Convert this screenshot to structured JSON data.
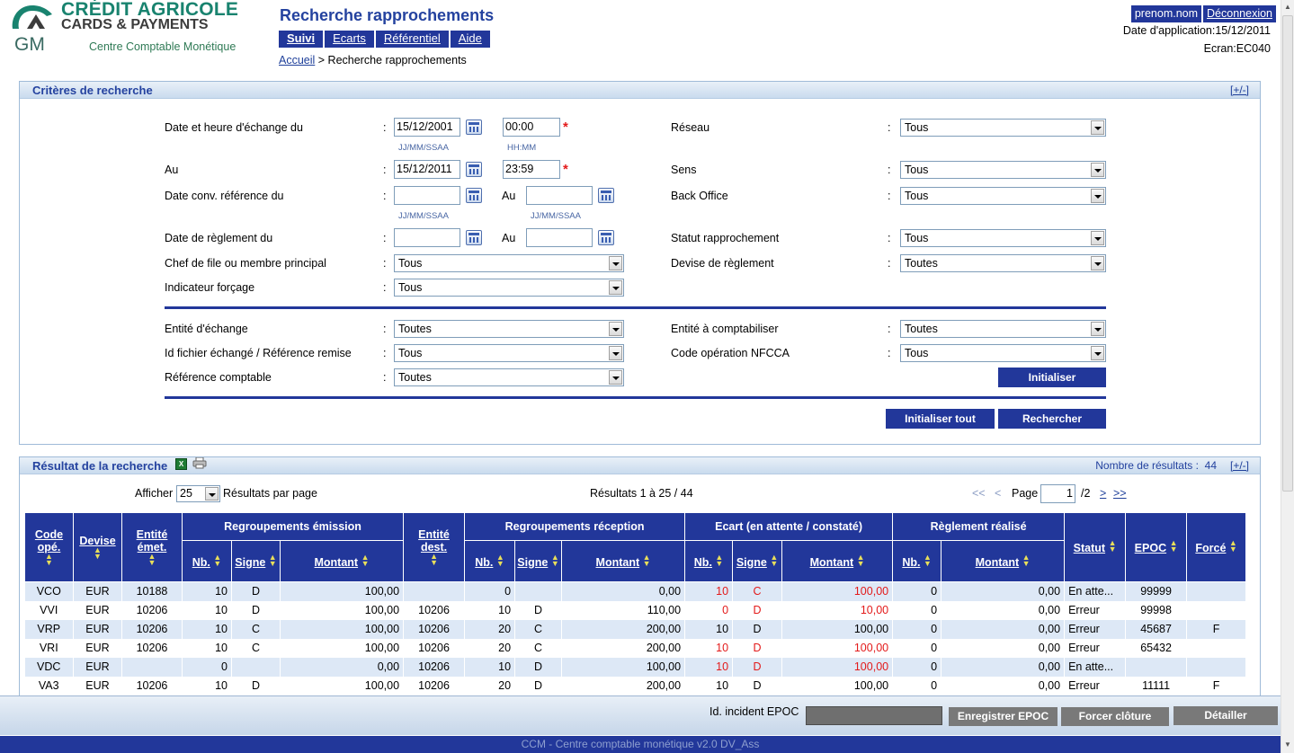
{
  "header": {
    "logo_line1": "CRÉDIT AGRICOLE",
    "logo_line2": "CARDS & PAYMENTS",
    "logo_gm": "GM",
    "logo_sub": "Centre Comptable Monétique",
    "page_title": "Recherche rapprochements",
    "menu": [
      "Suivi",
      "Ecarts",
      "Référentiel",
      "Aide"
    ],
    "breadcrumb_home": "Accueil",
    "breadcrumb_current": "> Recherche rapprochements",
    "user": "prenom.nom",
    "logout": "Déconnexion",
    "date_app": "Date d'application:15/12/2011",
    "ecran": "Ecran:EC040"
  },
  "criteria": {
    "title": "Critères de recherche",
    "toggle": "[+/-]",
    "labels": {
      "date_exchange_from": "Date et heure d'échange du",
      "to": "Au",
      "date_conv_from": "Date conv. référence du",
      "au_inline": "Au",
      "date_settle_from": "Date de règlement du",
      "lead_member": "Chef de file ou membre principal",
      "forcing": "Indicateur forçage",
      "network": "Réseau",
      "direction": "Sens",
      "back_office": "Back Office",
      "match_status": "Statut rapprochement",
      "settle_currency": "Devise de règlement",
      "exchange_entity": "Entité d'échange",
      "file_id": "Id fichier échangé / Référence remise",
      "accounting_ref": "Référence comptable",
      "accounting_entity": "Entité à comptabiliser",
      "nfcca_code": "Code opération NFCCA"
    },
    "colon": ":",
    "values": {
      "date_exchange_from": "15/12/2001",
      "time_from": "00:00",
      "date_exchange_to": "15/12/2011",
      "time_to": "23:59",
      "date_conv_from": "",
      "date_conv_to": "",
      "date_settle_from": "",
      "date_settle_to": "",
      "lead_member": "Tous",
      "forcing": "Tous",
      "network": "Tous",
      "direction": "Tous",
      "back_office": "Tous",
      "match_status": "Tous",
      "settle_currency": "Toutes",
      "exchange_entity": "Toutes",
      "file_id": "Tous",
      "accounting_ref": "Toutes",
      "accounting_entity": "Toutes",
      "nfcca_code": "Tous"
    },
    "hint_date": "JJ/MM/SSAA",
    "hint_time": "HH:MM",
    "required": "*",
    "btn_reset": "Initialiser",
    "btn_reset_all": "Initialiser tout",
    "btn_search": "Rechercher"
  },
  "results": {
    "title": "Résultat de la recherche",
    "count_label": "Nombre de résultats :",
    "count": "44",
    "toggle": "[+/-]",
    "show_label": "Afficher",
    "page_size": "25",
    "per_page": "Résultats par page",
    "range": "Résultats 1 à 25 / 44",
    "first": "<<",
    "prev": "<",
    "page_label": "Page",
    "page": "1",
    "page_total": "/2",
    "next": ">",
    "last": ">>",
    "group_headers": {
      "emission": "Regroupements émission",
      "reception": "Regroupements réception",
      "ecart": "Ecart (en attente / constaté)",
      "reglement": "Règlement réalisé"
    },
    "columns": {
      "code": "Code opé.",
      "devise": "Devise",
      "entite_emet": "Entité émet.",
      "nb": "Nb.",
      "signe": "Signe",
      "montant": "Montant",
      "entite_dest": "Entité dest.",
      "statut": "Statut",
      "epoc": "EPOC",
      "force": "Forcé"
    },
    "rows": [
      [
        "VCO",
        "EUR",
        "10188",
        "10",
        "D",
        "100,00",
        "",
        "0",
        "",
        "0,00",
        "10",
        "C",
        "100,00",
        "0",
        "0,00",
        "En atte...",
        "99999",
        ""
      ],
      [
        "VVI",
        "EUR",
        "10206",
        "10",
        "D",
        "100,00",
        "10206",
        "10",
        "D",
        "110,00",
        "0",
        "D",
        "10,00",
        "0",
        "0,00",
        "Erreur",
        "99998",
        ""
      ],
      [
        "VRP",
        "EUR",
        "10206",
        "10",
        "C",
        "100,00",
        "10206",
        "20",
        "C",
        "200,00",
        "10",
        "D",
        "100,00",
        "0",
        "0,00",
        "Erreur",
        "45687",
        "F"
      ],
      [
        "VRI",
        "EUR",
        "10206",
        "10",
        "C",
        "100,00",
        "10206",
        "20",
        "C",
        "200,00",
        "10",
        "D",
        "100,00",
        "0",
        "0,00",
        "Erreur",
        "65432",
        ""
      ],
      [
        "VDC",
        "EUR",
        "",
        "0",
        "",
        "0,00",
        "10206",
        "10",
        "D",
        "100,00",
        "10",
        "D",
        "100,00",
        "0",
        "0,00",
        "En atte...",
        "",
        ""
      ],
      [
        "VA3",
        "EUR",
        "10206",
        "10",
        "D",
        "100,00",
        "10206",
        "20",
        "D",
        "200,00",
        "10",
        "D",
        "100,00",
        "0",
        "0,00",
        "Erreur",
        "11111",
        "F"
      ]
    ],
    "red_flags": [
      true,
      true,
      false,
      true,
      true,
      false
    ]
  },
  "actions": {
    "incident_label": "Id. incident EPOC",
    "incident_value": "",
    "btn_register": "Enregistrer EPOC",
    "btn_force": "Forcer clôture",
    "btn_detail": "Détailler"
  },
  "footer": {
    "text": "CCM - Centre comptable monétique v2.0 DV_Ass"
  },
  "colors": {
    "brand_blue": "#22379a",
    "brand_green": "#19836f",
    "error_red": "#e31a1a"
  }
}
